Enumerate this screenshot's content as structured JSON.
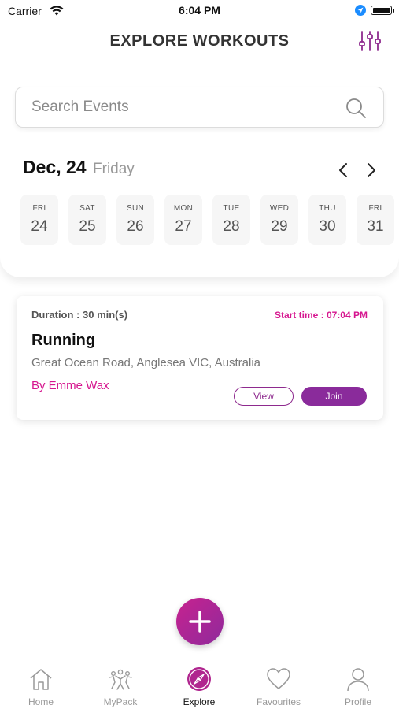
{
  "status_bar": {
    "carrier": "Carrier",
    "time": "6:04 PM"
  },
  "header": {
    "title": "EXPLORE WORKOUTS",
    "filter_icon": "sliders-icon",
    "accent_color": "#8e2a8e"
  },
  "search": {
    "placeholder": "Search Events",
    "value": ""
  },
  "date_header": {
    "date": "Dec, 24",
    "weekday": "Friday"
  },
  "days": [
    {
      "name": "FRI",
      "num": "24"
    },
    {
      "name": "SAT",
      "num": "25"
    },
    {
      "name": "SUN",
      "num": "26"
    },
    {
      "name": "MON",
      "num": "27"
    },
    {
      "name": "TUE",
      "num": "28"
    },
    {
      "name": "WED",
      "num": "29"
    },
    {
      "name": "THU",
      "num": "30"
    },
    {
      "name": "FRI",
      "num": "31"
    }
  ],
  "event": {
    "duration": "Duration : 30 min(s)",
    "start_time": "Start time : 07:04 PM",
    "title": "Running",
    "location": "Great Ocean Road, Anglesea VIC, Australia",
    "host": "By Emme Wax",
    "view_label": "View",
    "join_label": "Join"
  },
  "fab": {
    "icon": "plus-icon"
  },
  "tabs": [
    {
      "label": "Home",
      "icon": "home-icon"
    },
    {
      "label": "MyPack",
      "icon": "group-icon"
    },
    {
      "label": "Explore",
      "icon": "compass-icon"
    },
    {
      "label": "Favourites",
      "icon": "heart-icon"
    },
    {
      "label": "Profile",
      "icon": "user-icon"
    }
  ]
}
